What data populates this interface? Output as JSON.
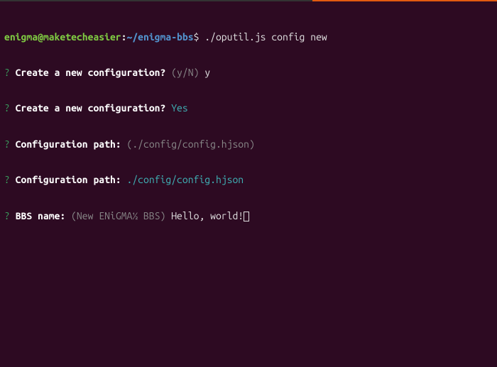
{
  "shell": {
    "user": "enigma@maketecheasier",
    "sep1": ":",
    "path": "~/enigma-bbs",
    "dollar": "$",
    "command": "./oputil.js config new"
  },
  "lines": [
    {
      "qmark": "?",
      "prompt": "Create a new configuration?",
      "hint": "(y/N)",
      "answer": "y",
      "answer_class": "answer"
    },
    {
      "qmark": "?",
      "prompt": "Create a new configuration?",
      "hint": "",
      "answer": "Yes",
      "answer_class": "answer-cyan"
    },
    {
      "qmark": "?",
      "prompt": "Configuration path:",
      "hint": "(./config/config.hjson)",
      "answer": "",
      "answer_class": "answer"
    },
    {
      "qmark": "?",
      "prompt": "Configuration path:",
      "hint": "",
      "answer": "./config/config.hjson",
      "answer_class": "answer-cyan"
    }
  ],
  "current": {
    "qmark": "?",
    "prompt": "BBS name:",
    "hint": "(New ENiGMA½ BBS)",
    "input": "Hello, world!"
  }
}
